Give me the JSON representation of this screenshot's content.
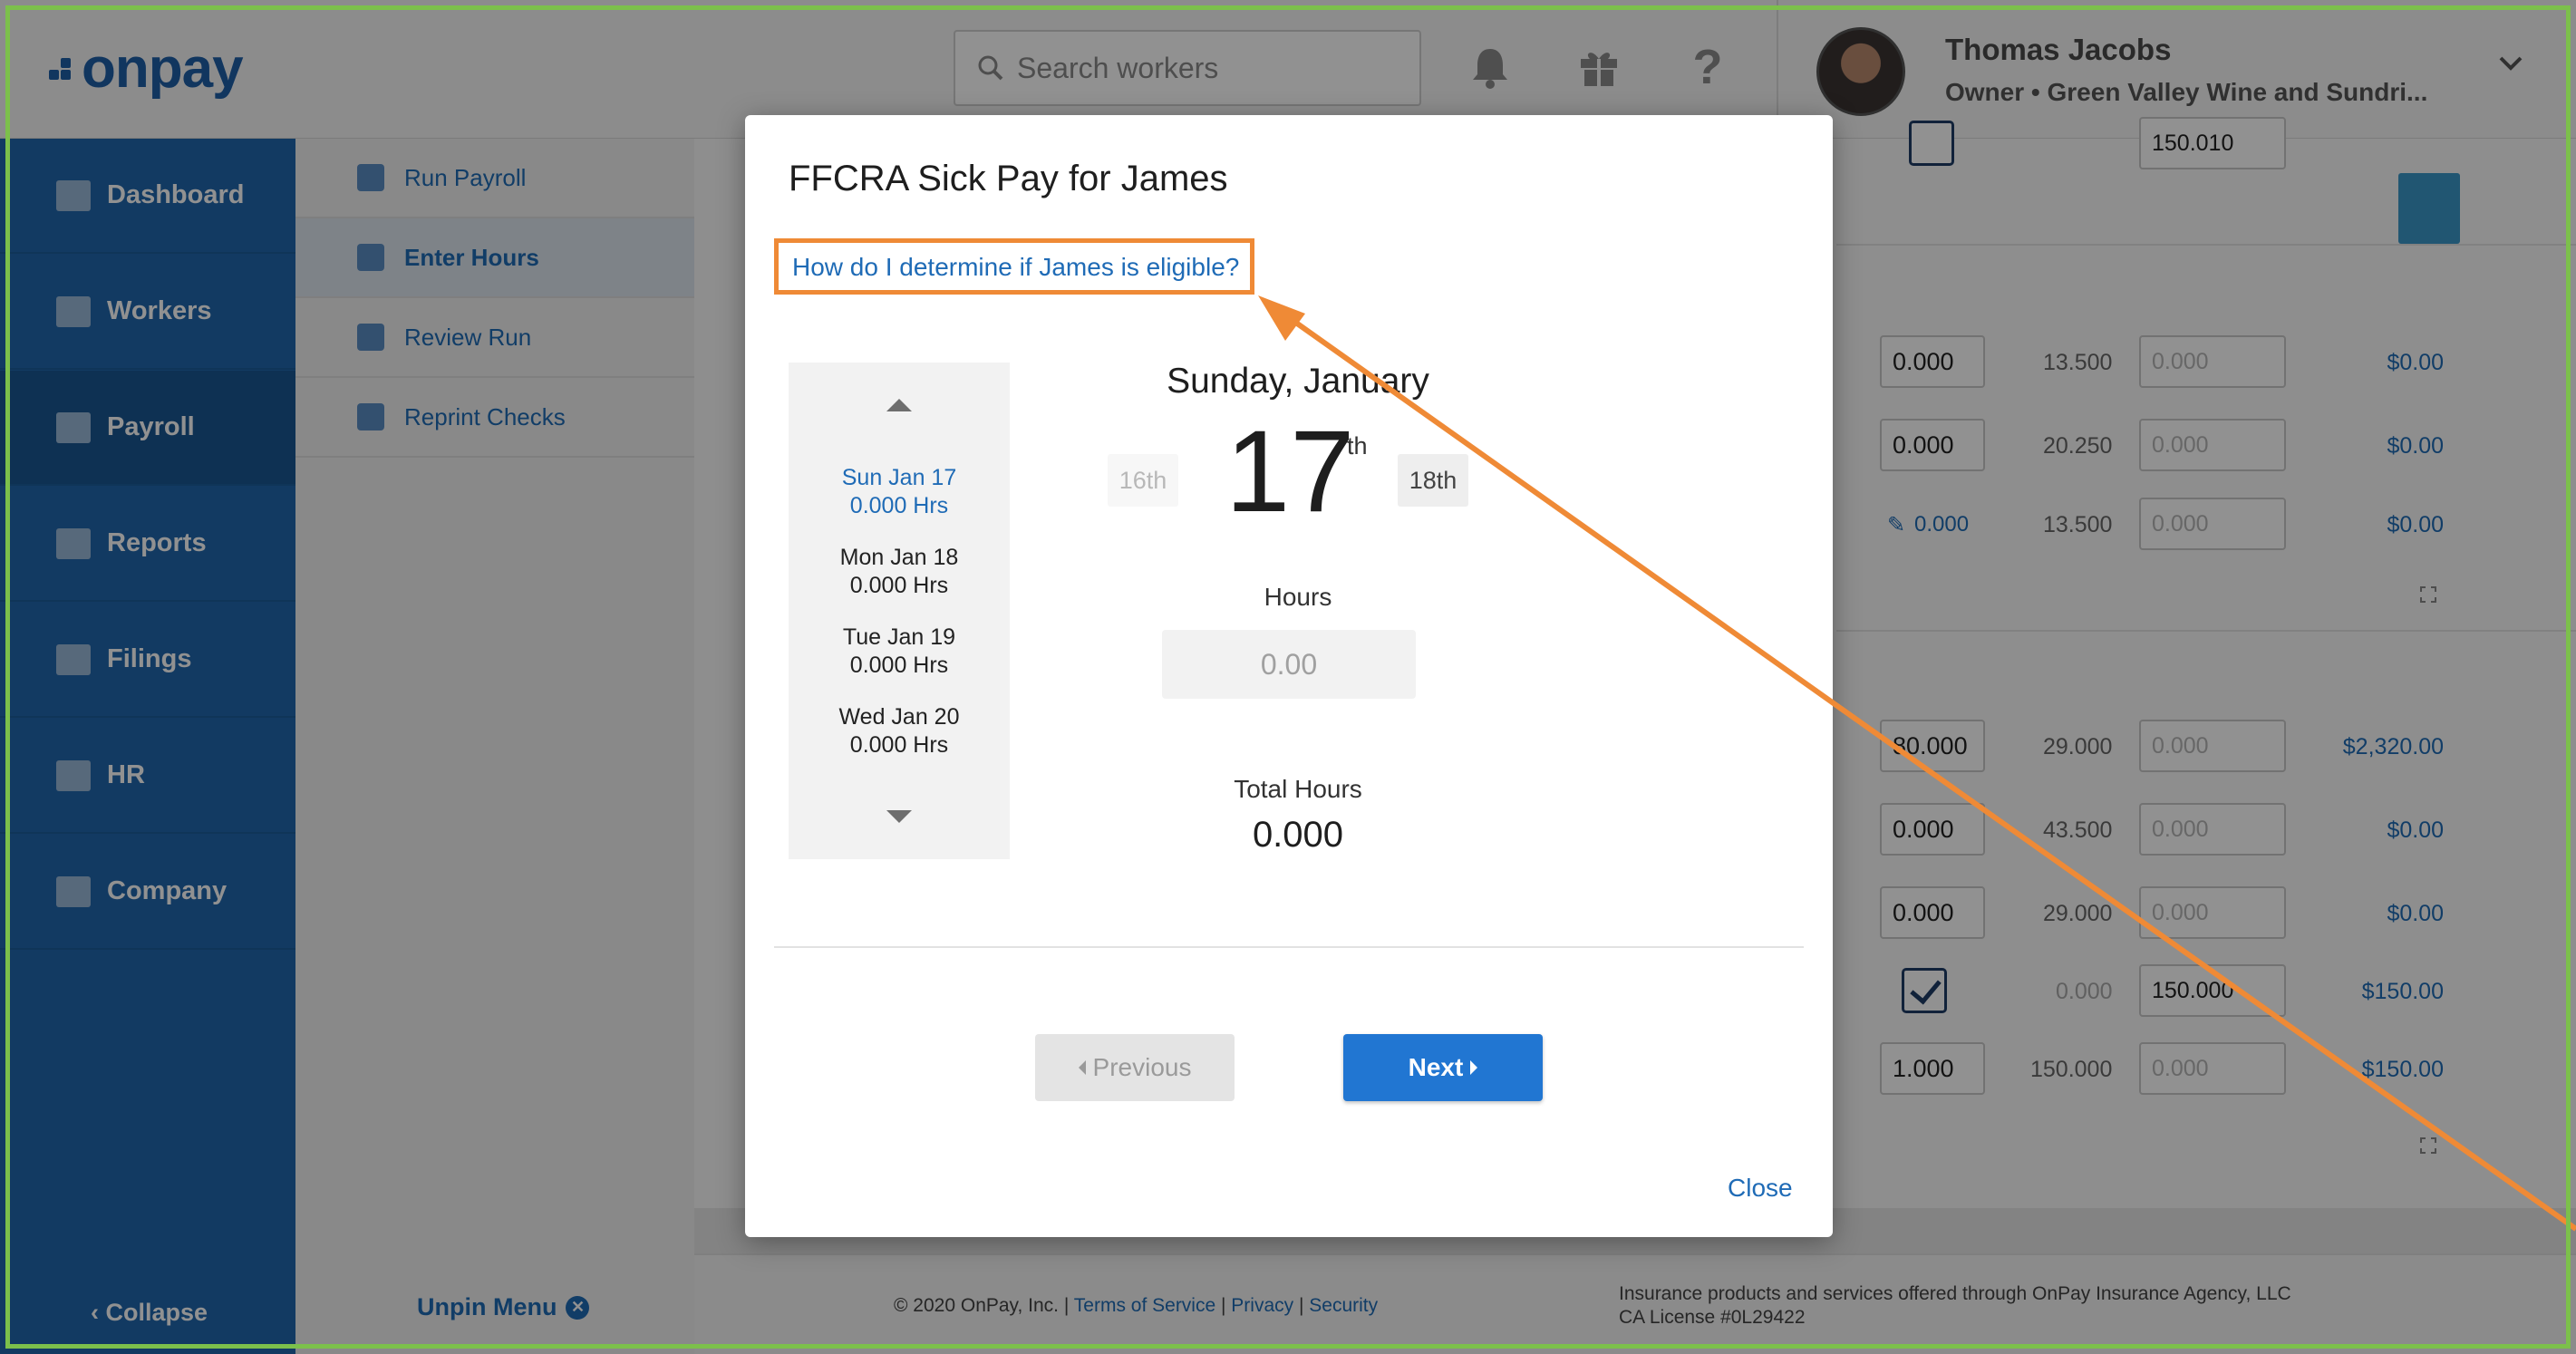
{
  "header": {
    "logo_text": "onpay",
    "search_placeholder": "Search workers",
    "user_name": "Thomas Jacobs",
    "user_role": "Owner • Green Valley Wine and Sundri...",
    "icons": [
      "bell-icon",
      "gift-icon",
      "help-icon",
      "chevron-down-icon"
    ]
  },
  "sidebar": {
    "items": [
      {
        "label": "Dashboard",
        "icon": "dashboard-icon"
      },
      {
        "label": "Workers",
        "icon": "workers-icon"
      },
      {
        "label": "Payroll",
        "icon": "payroll-icon",
        "active": true
      },
      {
        "label": "Reports",
        "icon": "reports-icon"
      },
      {
        "label": "Filings",
        "icon": "filings-icon"
      },
      {
        "label": "HR",
        "icon": "hr-icon"
      },
      {
        "label": "Company",
        "icon": "company-icon"
      }
    ],
    "collapse_label": "Collapse"
  },
  "submenu": {
    "items": [
      {
        "label": "Run Payroll"
      },
      {
        "label": "Enter Hours",
        "active": true
      },
      {
        "label": "Review Run"
      },
      {
        "label": "Reprint Checks"
      }
    ],
    "unpin_label": "Unpin Menu"
  },
  "background_rows": [
    {
      "hours": "0.000",
      "rate": "13.500",
      "extra": "0.000",
      "amount": "$0.00"
    },
    {
      "hours": "0.000",
      "rate": "20.250",
      "extra": "0.000",
      "amount": "$0.00"
    },
    {
      "hours": "0.000",
      "rate": "13.500",
      "extra": "0.000",
      "amount": "$0.00"
    },
    {
      "hours": "80.000",
      "rate": "29.000",
      "extra": "0.000",
      "amount": "$2,320.00"
    },
    {
      "hours": "0.000",
      "rate": "43.500",
      "extra": "0.000",
      "amount": "$0.00"
    },
    {
      "hours": "0.000",
      "rate": "29.000",
      "extra": "0.000",
      "amount": "$0.00"
    },
    {
      "hours": "",
      "rate": "0.000",
      "extra": "150.000",
      "amount": "$150.00"
    },
    {
      "hours": "1.000",
      "rate": "150.000",
      "extra": "0.000",
      "amount": "$150.00"
    }
  ],
  "top_partial": {
    "value": "150.010"
  },
  "footer": {
    "copyright": "© 2020 OnPay, Inc. |",
    "terms": "Terms of Service",
    "privacy": "Privacy",
    "security": "Security",
    "insurance_line1": "Insurance products and services offered through OnPay Insurance Agency, LLC",
    "insurance_line2": "CA License #0L29422"
  },
  "modal": {
    "title": "FFCRA Sick Pay for James",
    "eligibility_link": "How do I determine if James is eligible?",
    "days": [
      {
        "label": "Sun Jan 17",
        "hours": "0.000 Hrs",
        "active": true
      },
      {
        "label": "Mon Jan 18",
        "hours": "0.000 Hrs"
      },
      {
        "label": "Tue Jan 19",
        "hours": "0.000 Hrs"
      },
      {
        "label": "Wed Jan 20",
        "hours": "0.000 Hrs"
      }
    ],
    "date_heading": "Sunday, January",
    "day_number": "17",
    "day_suffix": "th",
    "prev_day": "16th",
    "next_day": "18th",
    "hours_label": "Hours",
    "hours_placeholder": "0.00",
    "total_label": "Total Hours",
    "total_value": "0.000",
    "previous_button": "Previous",
    "next_button": "Next",
    "close_link": "Close"
  },
  "colors": {
    "sidebar": "#2067ac",
    "link": "#1f6bb6",
    "primary_button": "#2176d2",
    "highlight_annotation": "#ef8a36",
    "frame": "#7cc04b"
  }
}
